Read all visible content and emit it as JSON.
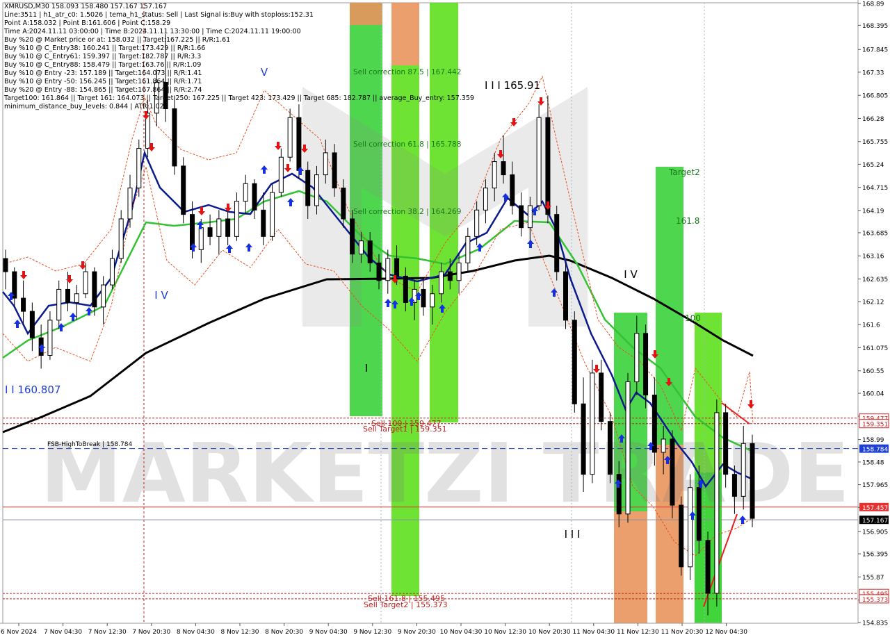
{
  "info_lines": [
    "XMRUSD,M30  158.093 158.480 157.167 157.167",
    "Line:3511 | h1_atr_c0: 1.5026 | tema_h1_status: Sell | Last Signal is:Buy with stoploss:152.31",
    "Point A:158.032 | Point B:161.606 | Point C:158.29",
    "Time A:2024.11.11 03:00:00 | Time B:2024.11.11 13:30:00 | Time C:2024.11.11 19:00:00",
    "Buy %20 @ Market price or at: 158.032 || Target:167.225 || R/R:1.61",
    "Buy %10 @ C_Entry38: 160.241 || Target:173.429 || R/R:1.66",
    "Buy %10 @ C_Entry61: 159.397 || Target:182.787 || R/R:3.3",
    "Buy %10 @ C_Entry88: 158.479 || Target:163.76 || R/R:1.09",
    "Buy %10 @ Entry -23: 157.189 || Target:164.073 || R/R:1.41",
    "Buy %10 @ Entry -50: 156.245 || Target:161.864 || R/R:1.71",
    "Buy %20 @ Entry -88: 154.865 || Target:167.864 || R/R:2.74",
    "Target100: 161.864 || Target 161: 164.073 || Target 250: 167.225 || Target 423: 173.429 || Target 685: 182.787 || average_Buy_entry: 157.359",
    "minimum_distance_buy_levels: 0.844 | ATR:1.023"
  ],
  "watermark": "MARKETZI TRADE",
  "chart_data": {
    "type": "candlestick",
    "symbol": "XMRUSD",
    "timeframe": "M30",
    "ylim": [
      154.835,
      168.89
    ],
    "y_ticks": [
      168.89,
      168.395,
      167.845,
      167.33,
      166.805,
      166.28,
      165.755,
      165.24,
      164.715,
      164.19,
      163.685,
      163.16,
      162.635,
      162.12,
      161.6,
      161.075,
      160.55,
      160.04,
      159.52,
      158.99,
      158.48,
      157.965,
      157.45,
      156.905,
      156.395,
      155.87,
      155.345,
      154.835
    ],
    "x_labels": [
      "6 Nov 2024",
      "7 Nov 04:30",
      "7 Nov 12:30",
      "7 Nov 20:30",
      "8 Nov 04:30",
      "8 Nov 12:30",
      "8 Nov 20:30",
      "9 Nov 04:30",
      "9 Nov 12:30",
      "9 Nov 20:30",
      "10 Nov 04:30",
      "10 Nov 12:30",
      "10 Nov 20:30",
      "11 Nov 04:30",
      "11 Nov 12:30",
      "11 Nov 20:30",
      "12 Nov 04:30"
    ],
    "price_tags": [
      {
        "label": "159.477",
        "value": 159.477,
        "color": "#cc2222"
      },
      {
        "label": "159.351",
        "value": 159.351,
        "color": "#cc2222"
      },
      {
        "label": "158.784",
        "value": 158.784,
        "color": "#1c3fd6"
      },
      {
        "label": "157.457",
        "value": 157.457,
        "color": "#e53030"
      },
      {
        "label": "157.167",
        "value": 157.167,
        "color": "#000000"
      },
      {
        "label": "155.495",
        "value": 155.495,
        "color": "#cc2222"
      },
      {
        "label": "155.373",
        "value": 155.373,
        "color": "#cc2222"
      }
    ],
    "horizontal_levels": [
      {
        "value": 159.477,
        "color": "#c02020",
        "style": "dashed"
      },
      {
        "value": 159.351,
        "color": "#c02020",
        "style": "dashed"
      },
      {
        "value": 158.784,
        "color": "#1c3fd6",
        "style": "dashed"
      },
      {
        "value": 157.457,
        "color": "#e53030",
        "style": "solid"
      },
      {
        "value": 157.167,
        "color": "#8a8fa0",
        "style": "solid"
      },
      {
        "value": 155.495,
        "color": "#c02020",
        "style": "dashed"
      },
      {
        "value": 155.373,
        "color": "#c02020",
        "style": "dashed"
      }
    ],
    "annotations": [
      {
        "text": "Sell correction 87.5 | 167.442",
        "color": "#1b7a1b"
      },
      {
        "text": "Sell correction 61.8 | 165.788",
        "color": "#1b7a1b"
      },
      {
        "text": "Sell correction 38.2 | 164.269",
        "color": "#1b7a1b"
      },
      {
        "text": "Sell 100 | 159.477",
        "color": "#c02020"
      },
      {
        "text": "Sell Target1 | 159.351",
        "color": "#c02020"
      },
      {
        "text": "Sell 161.8 | 155.495",
        "color": "#c02020"
      },
      {
        "text": "Sell Target2 | 155.373",
        "color": "#c02020"
      },
      {
        "text": "FSB-HighToBreak | 158.784",
        "color": "#000000"
      },
      {
        "text": "I I I 165.91",
        "color": "#000000"
      },
      {
        "text": "I I 160.807",
        "color": "#1c3fd6"
      },
      {
        "text": "V",
        "color": "#1c3fd6"
      },
      {
        "text": "I V",
        "color": "#1c3fd6"
      },
      {
        "text": "I V",
        "color": "#000000"
      },
      {
        "text": "I",
        "color": "#000000"
      },
      {
        "text": "I I I",
        "color": "#000000"
      },
      {
        "text": "Target2",
        "color": "#1b7a1b"
      },
      {
        "text": "161.8",
        "color": "#1b7a1b"
      },
      {
        "text": "100",
        "color": "#1b7a1b"
      }
    ],
    "series": [
      {
        "name": "",
        "color": "#0b1a8c",
        "values": []
      },
      {
        "name": "",
        "color": "#33c233",
        "values": []
      },
      {
        "name": "",
        "color": "#000000",
        "values": []
      }
    ],
    "candles_ohlc": [
      [
        163.1,
        163.3,
        162.4,
        162.8
      ],
      [
        162.8,
        162.9,
        162.0,
        162.2
      ],
      [
        162.2,
        162.6,
        161.6,
        161.9
      ],
      [
        161.9,
        162.1,
        161.0,
        161.3
      ],
      [
        161.3,
        161.6,
        160.6,
        160.9
      ],
      [
        160.9,
        161.9,
        160.8,
        161.7
      ],
      [
        161.7,
        162.6,
        161.5,
        162.4
      ],
      [
        162.4,
        162.8,
        161.9,
        162.1
      ],
      [
        162.1,
        162.5,
        161.7,
        162.3
      ],
      [
        162.3,
        163.0,
        162.2,
        162.8
      ],
      [
        162.8,
        162.9,
        161.8,
        162.0
      ],
      [
        162.0,
        162.7,
        161.6,
        162.5
      ],
      [
        162.5,
        163.3,
        162.4,
        163.1
      ],
      [
        163.1,
        164.2,
        163.0,
        164.0
      ],
      [
        164.0,
        165.0,
        163.8,
        164.7
      ],
      [
        164.7,
        165.8,
        164.5,
        165.6
      ],
      [
        165.6,
        166.7,
        165.4,
        166.4
      ],
      [
        166.4,
        167.4,
        166.1,
        167.1
      ],
      [
        167.1,
        168.2,
        166.2,
        166.5
      ],
      [
        166.5,
        166.8,
        165.0,
        165.2
      ],
      [
        165.2,
        165.4,
        163.9,
        164.1
      ],
      [
        164.1,
        164.4,
        163.1,
        163.3
      ],
      [
        163.3,
        164.0,
        163.0,
        163.8
      ],
      [
        163.8,
        164.1,
        163.4,
        163.6
      ],
      [
        163.6,
        164.2,
        163.2,
        164.0
      ],
      [
        164.0,
        164.3,
        163.4,
        163.6
      ],
      [
        163.6,
        164.6,
        163.5,
        164.4
      ],
      [
        164.4,
        165.0,
        164.1,
        164.8
      ],
      [
        164.8,
        164.9,
        164.0,
        164.2
      ],
      [
        164.2,
        164.6,
        163.4,
        163.6
      ],
      [
        163.6,
        164.8,
        163.5,
        164.6
      ],
      [
        164.6,
        165.6,
        164.5,
        165.4
      ],
      [
        165.4,
        166.5,
        165.3,
        166.3
      ],
      [
        166.3,
        166.6,
        164.9,
        165.1
      ],
      [
        165.1,
        165.3,
        164.0,
        164.3
      ],
      [
        164.3,
        165.2,
        164.1,
        165.0
      ],
      [
        165.0,
        165.8,
        164.8,
        165.5
      ],
      [
        165.5,
        165.7,
        164.5,
        164.7
      ],
      [
        164.7,
        164.9,
        163.8,
        164.0
      ],
      [
        164.0,
        164.2,
        163.0,
        163.2
      ],
      [
        163.2,
        163.7,
        163.0,
        163.5
      ],
      [
        163.5,
        163.7,
        162.8,
        163.0
      ],
      [
        163.0,
        163.2,
        162.4,
        162.6
      ],
      [
        162.6,
        163.3,
        162.3,
        163.1
      ],
      [
        163.1,
        163.4,
        162.5,
        162.7
      ],
      [
        162.7,
        162.9,
        161.9,
        162.1
      ],
      [
        162.1,
        162.6,
        161.7,
        162.4
      ],
      [
        162.4,
        162.6,
        161.8,
        162.0
      ],
      [
        162.0,
        162.5,
        161.6,
        162.3
      ],
      [
        162.3,
        163.0,
        162.1,
        162.8
      ],
      [
        162.8,
        163.1,
        162.4,
        162.6
      ],
      [
        162.6,
        163.2,
        162.3,
        163.0
      ],
      [
        163.0,
        163.8,
        162.8,
        163.6
      ],
      [
        163.6,
        164.4,
        163.4,
        164.2
      ],
      [
        164.2,
        164.9,
        163.9,
        164.7
      ],
      [
        164.7,
        165.5,
        164.4,
        165.3
      ],
      [
        165.3,
        165.9,
        164.8,
        165.0
      ],
      [
        165.0,
        165.3,
        164.1,
        164.3
      ],
      [
        164.3,
        164.6,
        163.6,
        163.8
      ],
      [
        163.8,
        164.5,
        163.5,
        164.3
      ],
      [
        164.3,
        166.6,
        164.2,
        166.3
      ],
      [
        166.3,
        166.8,
        163.9,
        164.1
      ],
      [
        164.1,
        164.3,
        162.6,
        162.8
      ],
      [
        162.8,
        163.0,
        161.5,
        161.7
      ],
      [
        161.7,
        161.9,
        159.6,
        159.8
      ],
      [
        159.8,
        160.4,
        157.8,
        158.2
      ],
      [
        158.2,
        160.8,
        158.0,
        160.5
      ],
      [
        160.5,
        160.8,
        159.2,
        159.4
      ],
      [
        159.4,
        159.6,
        158.0,
        158.2
      ],
      [
        158.2,
        158.5,
        157.0,
        157.3
      ],
      [
        157.3,
        160.5,
        157.1,
        160.3
      ],
      [
        160.3,
        161.8,
        160.0,
        161.4
      ],
      [
        161.4,
        161.6,
        159.7,
        160.0
      ],
      [
        160.0,
        160.4,
        158.4,
        158.7
      ],
      [
        158.7,
        159.3,
        158.2,
        159.0
      ],
      [
        159.0,
        159.2,
        157.2,
        157.5
      ],
      [
        157.5,
        157.7,
        155.9,
        156.1
      ],
      [
        156.1,
        158.2,
        155.8,
        157.9
      ],
      [
        157.9,
        158.4,
        156.4,
        156.7
      ],
      [
        156.7,
        156.9,
        155.0,
        155.5
      ],
      [
        155.5,
        159.9,
        155.2,
        159.6
      ],
      [
        159.6,
        159.8,
        157.9,
        158.2
      ],
      [
        158.2,
        158.4,
        157.3,
        157.7
      ],
      [
        157.7,
        159.3,
        157.4,
        158.9
      ],
      [
        158.9,
        159.1,
        157.0,
        157.2
      ]
    ]
  }
}
